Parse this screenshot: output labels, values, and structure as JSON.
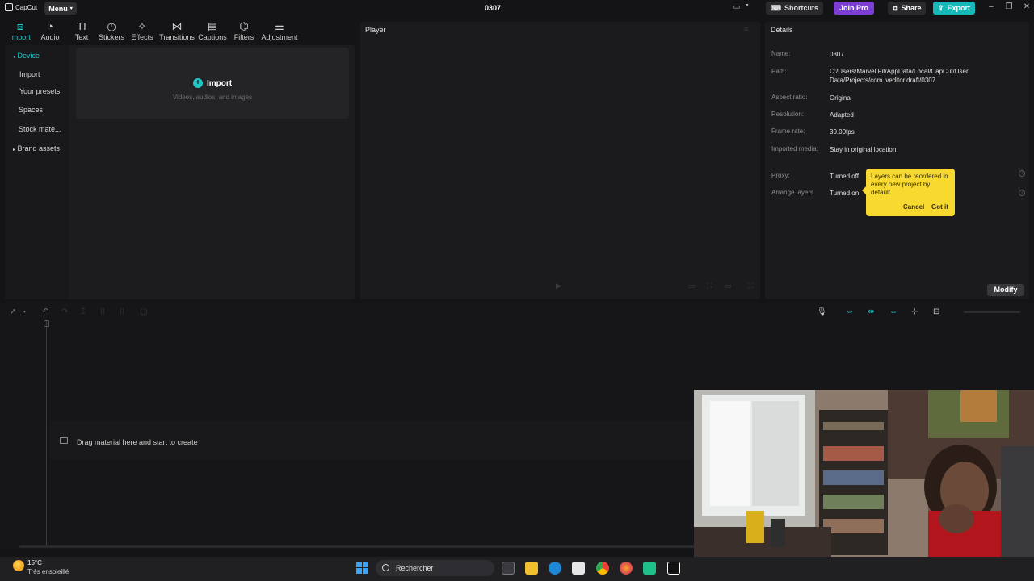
{
  "app": {
    "logo_text": "CapCut",
    "menu_label": "Menu",
    "project_title": "0307",
    "shortcuts_label": "Shortcuts",
    "join_pro_label": "Join Pro",
    "share_label": "Share",
    "export_label": "Export"
  },
  "toolbar": {
    "tabs": [
      {
        "label": "Import",
        "icon": "import-icon",
        "active": true
      },
      {
        "label": "Audio",
        "icon": "audio-icon"
      },
      {
        "label": "Text",
        "icon": "text-icon"
      },
      {
        "label": "Stickers",
        "icon": "sticker-icon"
      },
      {
        "label": "Effects",
        "icon": "effects-icon"
      },
      {
        "label": "Transitions",
        "icon": "transitions-icon"
      },
      {
        "label": "Captions",
        "icon": "captions-icon"
      },
      {
        "label": "Filters",
        "icon": "filters-icon"
      },
      {
        "label": "Adjustment",
        "icon": "adjustment-icon"
      }
    ]
  },
  "sidebar": {
    "items": [
      {
        "label": "Device",
        "active": true
      },
      {
        "label": "Import"
      },
      {
        "label": "Your presets"
      },
      {
        "label": "Spaces"
      },
      {
        "label": "Stock mate..."
      },
      {
        "label": "Brand assets"
      }
    ]
  },
  "import_panel": {
    "button_label": "Import",
    "subtitle": "Videos, audios, and images"
  },
  "player": {
    "title": "Player"
  },
  "details": {
    "title": "Details",
    "rows": [
      {
        "label": "Name:",
        "value": "0307"
      },
      {
        "label": "Path:",
        "value": "C:/Users/Marvel Fit/AppData/Local/CapCut/User Data/Projects/com.lveditor.draft/0307"
      },
      {
        "label": "Aspect ratio:",
        "value": "Original"
      },
      {
        "label": "Resolution:",
        "value": "Adapted"
      },
      {
        "label": "Frame rate:",
        "value": "30.00fps"
      },
      {
        "label": "Imported media:",
        "value": "Stay in original location"
      },
      {
        "label": "Proxy:",
        "value": "Turned off"
      },
      {
        "label": "Arrange layers",
        "value": "Turned on"
      }
    ],
    "modify_label": "Modify",
    "tooltip": {
      "text": "Layers can be reordered in every new project by default.",
      "cancel_label": "Cancel",
      "got_it_label": "Got it"
    }
  },
  "timeline": {
    "drag_hint": "Drag material here and start to create"
  },
  "taskbar": {
    "weather_temp": "15°C",
    "weather_desc": "Très ensoleillé",
    "search_placeholder": "Rechercher"
  },
  "colors": {
    "accent": "#1ec6c6",
    "tooltip": "#f7d930",
    "pro": "#7b3fd6"
  }
}
